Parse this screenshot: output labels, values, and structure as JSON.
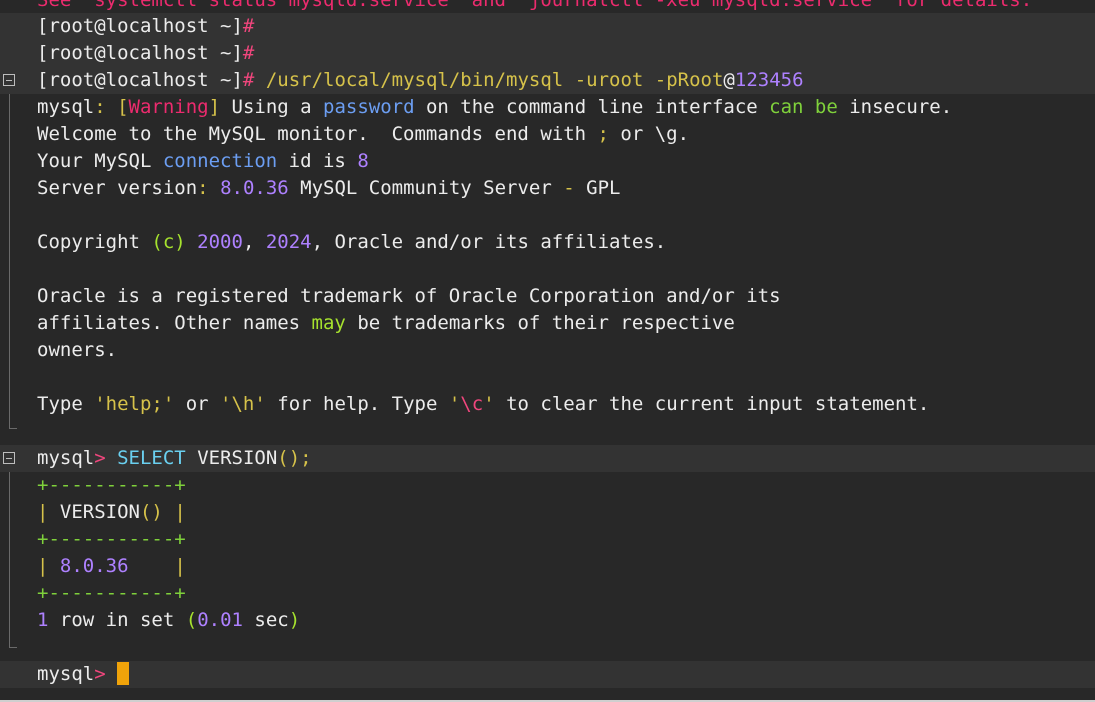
{
  "colors": {
    "background": "#282828",
    "highlight_line": "#333333",
    "cursor": "#f0a30a",
    "foreground": "#ececec",
    "warning_red": "#ec2b6e",
    "number_purple": "#ae81ff",
    "keyword_green": "#7fd13b",
    "keyword_blue": "#6c9ef2",
    "sql_cyan": "#6ad0f0"
  },
  "lines": {
    "l0": "See \"systemctl status mysqld.service\" and \"journalctl -xeu mysqld.service\" for details.",
    "l1_prompt": "[root@localhost ~]",
    "l1_hash": "#",
    "l2_prompt": "[root@localhost ~]",
    "l2_hash": "#",
    "l3_prompt": "[root@localhost ~]",
    "l3_hash": "#",
    "l3_cmd": "/usr/local/mysql/bin/mysql",
    "l3_arg1": "-uroot",
    "l3_arg2a": "-pRoot",
    "l3_at": "@",
    "l3_arg2b": "123456",
    "l4_a": "mysql",
    "l4_b": ": ",
    "l4_c": "[",
    "l4_d": "Warning",
    "l4_e": "]",
    "l4_f": " Using a ",
    "l4_g": "password",
    "l4_h": " on the command line interface ",
    "l4_i": "can be",
    "l4_j": " insecure.",
    "l5_a": "Welcome to the MySQL monitor.  Commands end with ",
    "l5_b": ";",
    "l5_c": " or \\g.",
    "l6_a": "Your MySQL ",
    "l6_b": "connection",
    "l6_c": " id is ",
    "l6_d": "8",
    "l7_a": "Server version",
    "l7_b": ":",
    "l7_c": " ",
    "l7_d": "8.0.36",
    "l7_e": " MySQL Community Server ",
    "l7_f": "-",
    "l7_g": " GPL",
    "l9_a": "Copyright ",
    "l9_b": "(c)",
    "l9_c": " ",
    "l9_d": "2000",
    "l9_e": ", ",
    "l9_f": "2024",
    "l9_g": ", Oracle and/or its affiliates.",
    "l11": "Oracle is a registered trademark of Oracle Corporation and/or its",
    "l12_a": "affiliates. Other names ",
    "l12_b": "may",
    "l12_c": " be trademarks of their respective",
    "l13": "owners.",
    "l15_a": "Type ",
    "l15_b": "'help;'",
    "l15_c": " or ",
    "l15_d": "'\\h'",
    "l15_e": " for help. Type ",
    "l15_f": "'",
    "l15_g": "\\c",
    "l15_h": "'",
    "l15_i": " to clear the current input statement.",
    "l17_a": "mysql",
    "l17_b": ">",
    "l17_c": " ",
    "l17_d": "SELECT",
    "l17_e": " VERSION",
    "l17_f": "();",
    "l18": "+-----------+",
    "l19_a": "|",
    "l19_b": " VERSION",
    "l19_c": "()",
    "l19_d": " ",
    "l19_e": "|",
    "l20": "+-----------+",
    "l21_a": "|",
    "l21_b": " ",
    "l21_c": "8.0.36",
    "l21_d": "    ",
    "l21_e": "|",
    "l22": "+-----------+",
    "l23_a": "1",
    "l23_b": " row in set ",
    "l23_c": "(",
    "l23_d": "0.01",
    "l23_e": " sec",
    "l23_f": ")",
    "l25_a": "mysql",
    "l25_b": ">"
  }
}
